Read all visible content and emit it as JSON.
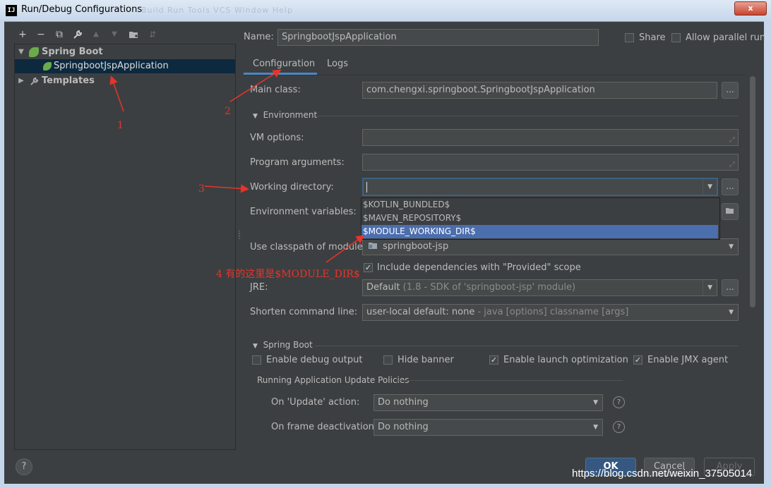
{
  "window": {
    "app_icon": "IJ",
    "title": "Run/Debug Configurations",
    "title_blurred": "Build Run Tools VCS Window Help",
    "close_label": "x"
  },
  "toolbar": {
    "add": "+",
    "remove": "−",
    "copy": "⧉",
    "edit": "🔧",
    "up": "▲",
    "down": "▼",
    "folder": "📁",
    "sort": "⇵"
  },
  "tree": {
    "spring_boot": "Spring Boot",
    "app": "SpringbootJspApplication",
    "templates": "Templates"
  },
  "header": {
    "name_label": "Name:",
    "name_value": "SpringbootJspApplication",
    "share_label": "Share",
    "parallel_label": "Allow parallel run"
  },
  "tabs": [
    "Configuration",
    "Logs"
  ],
  "config": {
    "main_class_label": "Main class:",
    "main_class_value": "com.chengxi.springboot.SpringbootJspApplication",
    "environment_section": "Environment",
    "vm_options_label": "VM options:",
    "program_args_label": "Program arguments:",
    "working_dir_label": "Working directory:",
    "working_dir_value": "",
    "env_vars_label": "Environment variables:",
    "classpath_label": "Use classpath of module:",
    "classpath_value": "springboot-jsp",
    "include_deps_label": "Include dependencies with \"Provided\" scope",
    "jre_label": "JRE:",
    "jre_value": "Default",
    "jre_hint": "(1.8 - SDK of 'springboot-jsp' module)",
    "shorten_label": "Shorten command line:",
    "shorten_value": "user-local default: none",
    "shorten_hint": "- java [options] classname [args]",
    "ellipsis": "..."
  },
  "working_dir_options": [
    "$KOTLIN_BUNDLED$",
    "$MAVEN_REPOSITORY$",
    "$MODULE_WORKING_DIR$"
  ],
  "spring_boot": {
    "section": "Spring Boot",
    "debug_output": "Enable debug output",
    "hide_banner": "Hide banner",
    "launch_opt": "Enable launch optimization",
    "jmx_agent": "Enable JMX agent",
    "policies_label": "Running Application Update Policies",
    "update_label": "On 'Update' action:",
    "update_value": "Do nothing",
    "frame_label": "On frame deactivation:",
    "frame_value": "Do nothing"
  },
  "buttons": {
    "help": "?",
    "ok": "OK",
    "cancel": "Cancel",
    "apply": "Apply"
  },
  "annotations": {
    "a1": "1",
    "a2": "2",
    "a3": "3",
    "a4": "4 有的这里是$MODULE_DIR$"
  },
  "watermark": "https://blog.csdn.net/weixin_37505014",
  "colors": {
    "background": "#3c3f41",
    "selection": "#4b6eaf",
    "tab_underline": "#4a88c7",
    "annotation": "#e8332b",
    "ok_button": "#365880"
  }
}
